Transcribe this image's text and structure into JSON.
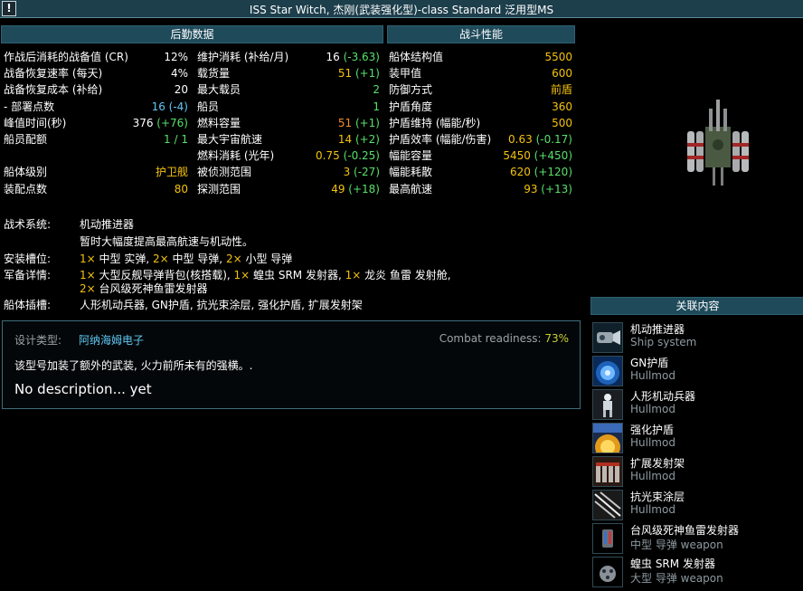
{
  "title": "ISS Star Witch, 杰刚(武装强化型)-class Standard 泛用型MS",
  "warning_glyph": "!",
  "logistics": {
    "header": "后勤数据",
    "col1": [
      {
        "label": "作战后消耗的战备值 (CR)",
        "value": "12%",
        "color": "w"
      },
      {
        "label": "战备恢复速率 (每天)",
        "value": "4%",
        "color": "w"
      },
      {
        "label": "战备恢复成本 (补给)",
        "value": "20",
        "color": "w"
      },
      {
        "label": " - 部署点数",
        "value": "16 (-4)",
        "color": "b"
      },
      {
        "label": "峰值时间(秒)",
        "value": "376 (+76)",
        "color": "w",
        "delta": "g"
      },
      {
        "label": "船员配额",
        "value": "1 / 1",
        "color": "g"
      },
      {
        "label": "",
        "value": "",
        "color": "w"
      },
      {
        "label": "船体级别",
        "value": "护卫舰",
        "color": "y"
      },
      {
        "label": "装配点数",
        "value": "80",
        "color": "y"
      }
    ],
    "col2": [
      {
        "label": "维护消耗 (补给/月)",
        "value": "16 (-3.63)",
        "color": "w",
        "delta": "g"
      },
      {
        "label": "载货量",
        "value": "51 (+1)",
        "color": "y",
        "delta": "g"
      },
      {
        "label": "最大载员",
        "value": "2",
        "color": "g"
      },
      {
        "label": "船员",
        "value": "1",
        "color": "g"
      },
      {
        "label": "燃料容量",
        "value": "51 (+1)",
        "color": "o",
        "delta": "g"
      },
      {
        "label": "最大宇宙航速",
        "value": "14 (+2)",
        "color": "y",
        "delta": "g"
      },
      {
        "label": "燃料消耗 (光年)",
        "value": "0.75 (-0.25)",
        "color": "y",
        "delta": "g"
      },
      {
        "label": "被侦测范围",
        "value": "3 (-27)",
        "color": "y",
        "delta": "g"
      },
      {
        "label": "探测范围",
        "value": "49 (+18)",
        "color": "y",
        "delta": "g"
      }
    ]
  },
  "combat": {
    "header": "战斗性能",
    "rows": [
      {
        "label": "船体结构值",
        "value": "5500",
        "color": "y"
      },
      {
        "label": "装甲值",
        "value": "600",
        "color": "y"
      },
      {
        "label": "防御方式",
        "value": "前盾",
        "color": "y"
      },
      {
        "label": "护盾角度",
        "value": "360",
        "color": "y"
      },
      {
        "label": "护盾维持 (幅能/秒)",
        "value": "500",
        "color": "y"
      },
      {
        "label": "护盾效率 (幅能/伤害)",
        "value": "0.63 (-0.17)",
        "color": "y",
        "delta": "g"
      },
      {
        "label": "幅能容量",
        "value": "5450 (+450)",
        "color": "y",
        "delta": "g"
      },
      {
        "label": "幅能耗散",
        "value": "620 (+120)",
        "color": "y",
        "delta": "g"
      },
      {
        "label": "最高航速",
        "value": "93 (+13)",
        "color": "y",
        "delta": "g"
      }
    ]
  },
  "systems": {
    "tactical_label": "战术系统:",
    "tactical_name": "机动推进器",
    "tactical_desc": "暂时大幅度提高最高航速与机动性。",
    "mounts_label": "安装槽位:",
    "mounts": [
      {
        "count": "1×",
        "text": " 中型 实弹, "
      },
      {
        "count": "2×",
        "text": " 中型 导弹, "
      },
      {
        "count": "2×",
        "text": " 小型 导弹"
      }
    ],
    "armaments_label": "军备详情:",
    "armaments_line1": [
      {
        "count": "1×",
        "text": " 大型反舰导弹背包(核搭载), "
      },
      {
        "count": "1×",
        "text": " 蝗虫 SRM 发射器, "
      },
      {
        "count": "1×",
        "text": " 龙炎 鱼雷 发射舱,"
      }
    ],
    "armaments_line2": [
      {
        "count": "2×",
        "text": " 台风级死神鱼雷发射器"
      }
    ],
    "hullmods_label": "船体插槽:",
    "hullmods_text": "人形机动兵器, GN护盾, 抗光束涂层, 强化护盾, 扩展发射架"
  },
  "design": {
    "type_label": "设计类型:",
    "type_value": "阿纳海姆电子",
    "cr_label": "Combat readiness:",
    "cr_value": "73%",
    "description": "该型号加装了额外的武装, 火力前所未有的强横。.",
    "no_desc": "No description... yet"
  },
  "related": {
    "header": "关联内容",
    "items": [
      {
        "name": "机动推进器",
        "type": "Ship system",
        "icon": "thruster-icon"
      },
      {
        "name": "GN护盾",
        "type": "Hullmod",
        "icon": "gn-shield-icon"
      },
      {
        "name": "人形机动兵器",
        "type": "Hullmod",
        "icon": "humanoid-mech-icon"
      },
      {
        "name": "强化护盾",
        "type": "Hullmod",
        "icon": "hardened-shield-icon"
      },
      {
        "name": "扩展发射架",
        "type": "Hullmod",
        "icon": "expanded-racks-icon"
      },
      {
        "name": "抗光束涂层",
        "type": "Hullmod",
        "icon": "beam-coating-icon"
      },
      {
        "name": "台风级死神鱼雷发射器",
        "type": "中型 导弹 weapon",
        "icon": "torpedo-launcher-icon"
      },
      {
        "name": "蝗虫 SRM 发射器",
        "type": "大型 导弹 weapon",
        "icon": "srm-launcher-icon"
      }
    ]
  },
  "colors": {
    "yellow": "#f4c20d",
    "green": "#57e06a",
    "orange": "#f38c2b",
    "blue": "#5fc8f4",
    "header_bg": "#1e4a5a"
  }
}
